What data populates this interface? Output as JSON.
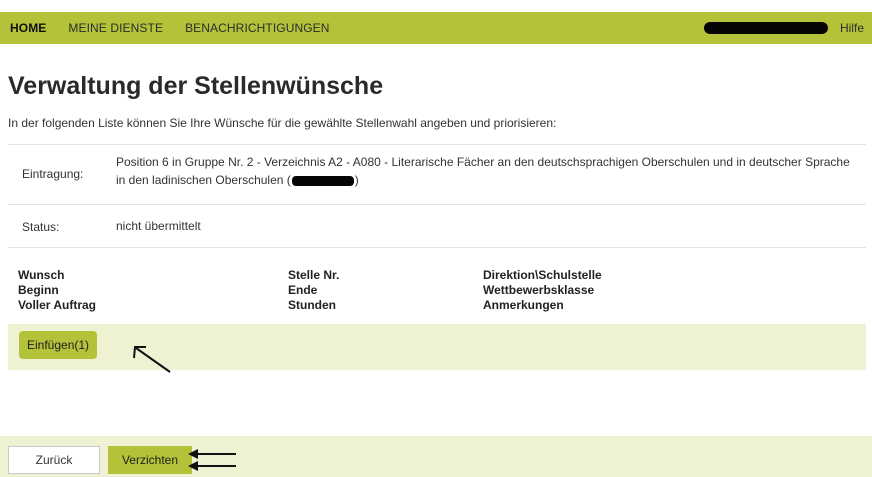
{
  "nav": {
    "home": "HOME",
    "my_services": "MEINE DIENSTE",
    "notifications": "BENACHRICHTIGUNGEN",
    "help": "Hilfe"
  },
  "page": {
    "title": "Verwaltung der Stellenwünsche",
    "subtitle": "In der folgenden Liste können Sie Ihre Wünsche für die gewählte Stellenwahl angeben und priorisieren:"
  },
  "info": {
    "entry_label": "Eintragung:",
    "entry_value_before": "Position 6 in Gruppe Nr. 2 - Verzeichnis A2 - A080 - Literarische Fächer an den deutschsprachigen Oberschulen und in deutscher Sprache in den ladinischen Oberschulen (",
    "entry_value_after": ")",
    "status_label": "Status:",
    "status_value": "nicht übermittelt"
  },
  "table": {
    "headers": [
      [
        "Wunsch",
        "Beginn",
        "Voller Auftrag"
      ],
      [
        "Stelle Nr.",
        "Ende",
        "Stunden"
      ],
      [
        "Direktion\\Schulstelle",
        "Wettbewerbsklasse",
        "Anmerkungen"
      ]
    ]
  },
  "actions": {
    "insert": "Einfügen(1)",
    "back": "Zurück",
    "renounce": "Verzichten"
  },
  "colors": {
    "accent": "#b4c23a",
    "band": "#eef1d2"
  }
}
